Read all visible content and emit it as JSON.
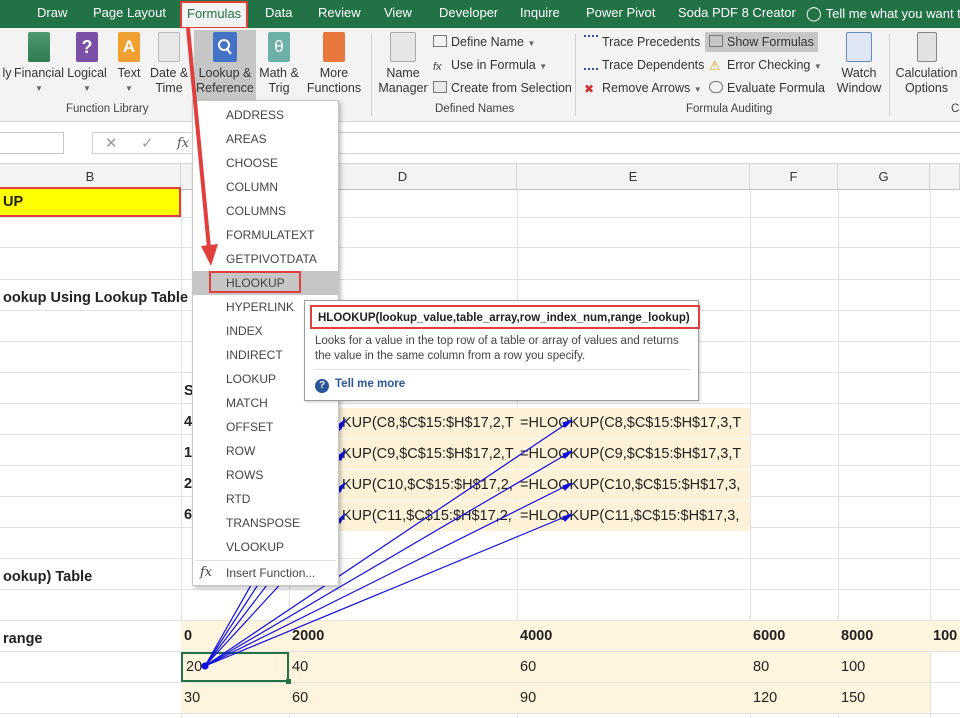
{
  "tabs": [
    {
      "label": "Draw",
      "active": false
    },
    {
      "label": "Page Layout",
      "active": false
    },
    {
      "label": "Formulas",
      "active": true
    },
    {
      "label": "Data",
      "active": false
    },
    {
      "label": "Review",
      "active": false
    },
    {
      "label": "View",
      "active": false
    },
    {
      "label": "Developer",
      "active": false
    },
    {
      "label": "Inquire",
      "active": false
    },
    {
      "label": "Power Pivot",
      "active": false
    },
    {
      "label": "Soda PDF 8 Creator",
      "active": false
    }
  ],
  "tell_me": "Tell me what you want to",
  "ribbon": {
    "function_library": {
      "label": "Function Library",
      "buttons": [
        "ly",
        "Financial",
        "Logical",
        "Text",
        "Date &\nTime",
        "Lookup &\nReference",
        "Math &\nTrig",
        "More\nFunctions"
      ]
    },
    "defined_names": {
      "label": "Defined Names",
      "name_manager": "Name\nManager",
      "define_name": "Define Name",
      "use_in_formula": "Use in Formula",
      "create_from_selection": "Create from Selection"
    },
    "formula_auditing": {
      "label": "Formula Auditing",
      "trace_precedents": "Trace Precedents",
      "trace_dependents": "Trace Dependents",
      "remove_arrows": "Remove Arrows",
      "show_formulas": "Show Formulas",
      "error_checking": "Error Checking",
      "evaluate_formula": "Evaluate Formula",
      "watch_window": "Watch\nWindow"
    },
    "calculation": {
      "label": "Ca",
      "calc_options": "Calculation\nOptions"
    }
  },
  "formula_bar": {
    "fx": "fx"
  },
  "columns": [
    "B",
    "D",
    "E",
    "F",
    "G"
  ],
  "cells": {
    "b_title": "UP",
    "b_heading": "ookup Using Lookup Table",
    "c_s": "S",
    "c_4": "4",
    "c_1": "1",
    "c_2": "2",
    "c_6": "6",
    "d8": "KUP(C8,$C$15:$H$17,2,T",
    "d9": "KUP(C9,$C$15:$H$17,2,T",
    "d10": "KUP(C10,$C$15:$H$17,2,",
    "d11": "KUP(C11,$C$15:$H$17,2,",
    "e8": "=HLOOKUP(C8,$C$15:$H$17,3,T",
    "e9": "=HLOOKUP(C9,$C$15:$H$17,3,T",
    "e10": "=HLOOKUP(C10,$C$15:$H$17,3,",
    "e11": "=HLOOKUP(C11,$C$15:$H$17,3,",
    "b_table": "ookup) Table",
    "b_range": "range",
    "row15": [
      "0",
      "2000",
      "4000",
      "6000",
      "8000",
      "100"
    ],
    "row16": [
      "20",
      "40",
      "60",
      "80",
      "100"
    ],
    "row17": [
      "30",
      "60",
      "90",
      "120",
      "150"
    ]
  },
  "menu_items": [
    "ADDRESS",
    "AREAS",
    "CHOOSE",
    "COLUMN",
    "COLUMNS",
    "FORMULATEXT",
    "GETPIVOTDATA",
    "HLOOKUP",
    "HYPERLINK",
    "INDEX",
    "INDIRECT",
    "LOOKUP",
    "MATCH",
    "OFFSET",
    "ROW",
    "ROWS",
    "RTD",
    "TRANSPOSE",
    "VLOOKUP"
  ],
  "menu_highlighted": "HLOOKUP",
  "insert_function": "Insert Function...",
  "tooltip": {
    "signature": "HLOOKUP(lookup_value,table_array,row_index_num,range_lookup)",
    "description": "Looks for a value in the top row of a table or array of values and returns the value in the same column from a row you specify.",
    "tell_me_more": "Tell me more"
  },
  "colors": {
    "excel_green": "#217346",
    "highlight_red": "#e0403d",
    "arrow_blue": "#1010dd",
    "cell_fill": "#fdf2d8",
    "title_fill": "#ffff00"
  }
}
